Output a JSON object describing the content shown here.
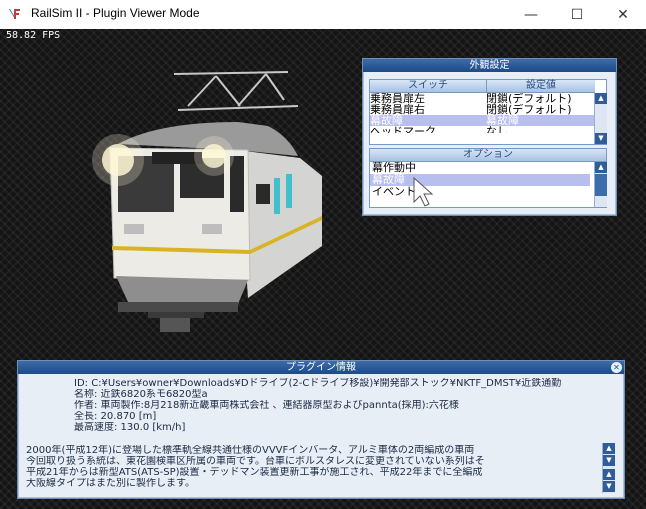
{
  "window": {
    "title": "RailSim II - Plugin Viewer Mode",
    "min_glyph": "—",
    "max_glyph": "☐",
    "close_glyph": "✕"
  },
  "viewport": {
    "fps": "58.82 FPS"
  },
  "appearance_panel": {
    "title": "外観設定",
    "col_switch": "スイッチ",
    "col_value": "設定値",
    "rows": [
      {
        "switch": "乗務員扉左",
        "value": "閉鎖(デフォルト)"
      },
      {
        "switch": "乗務員扉右",
        "value": "閉鎖(デフォルト)"
      },
      {
        "switch": "幕故障",
        "value": "幕故障"
      },
      {
        "switch": "ヘッドマーク",
        "value": "なし"
      }
    ]
  },
  "options_panel": {
    "title": "オプション",
    "items": [
      "幕作動中",
      "幕故障",
      "イベント中"
    ]
  },
  "info_panel": {
    "title": "プラグイン情報",
    "id_line": "ID: C:¥Users¥owner¥Downloads¥Dドライブ(2-Cドライブ移設)¥開発部ストック¥NKTF_DMST¥近鉄通勤",
    "name_line": "名称: 近鉄6820系モ6820型a",
    "author_line": "作者: 車両製作:8月218新近畿車両株式会社 、連結器原型およびpannta(採用):六花様",
    "length_line": "全長: 20.870 [m]",
    "speed_line": "最高速度: 130.0 [km/h]",
    "desc": [
      "2000年(平成12年)に登場した標準軌全線共通仕様のVVVFインバータ、アルミ車体の2両編成の車両",
      "今回取り扱う系統は、東花園検車区所属の車両です。台車にボルスタレスに変更されていない系列はそ",
      "平成21年からは新型ATS(ATS-SP)設置・デッドマン装置更新工事が施工され、平成22年までに全編成",
      "大阪線タイプはまた別に製作します。"
    ]
  },
  "colors": {
    "panel_header": "#1c4a86",
    "selection": "#b8bfee",
    "train_stripe": "#d8b324"
  }
}
